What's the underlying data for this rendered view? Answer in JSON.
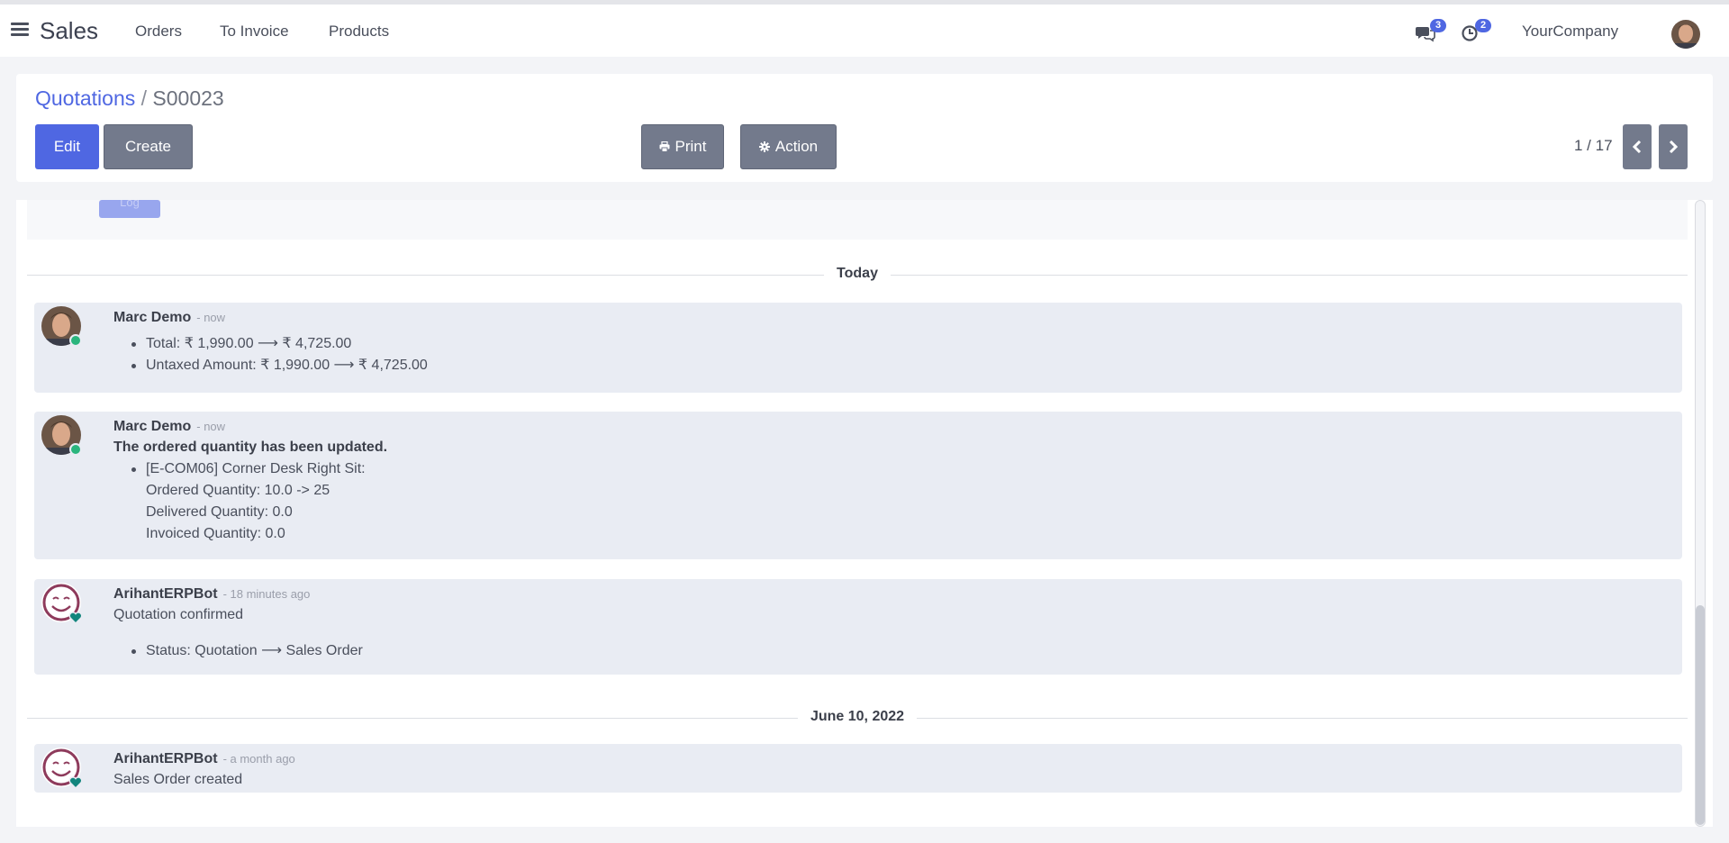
{
  "navbar": {
    "app_title": "Sales",
    "menu_items": [
      "Orders",
      "To Invoice",
      "Products"
    ],
    "messages_badge": "3",
    "activities_badge": "2",
    "company": "YourCompany"
  },
  "breadcrumb": {
    "parent": "Quotations",
    "separator": "/",
    "current": "S00023"
  },
  "buttons": {
    "edit": "Edit",
    "create": "Create",
    "print": "Print",
    "action": "Action"
  },
  "pager": {
    "value": "1 / 17"
  },
  "chatter": {
    "log_button_partial": "Log",
    "sections": [
      {
        "date_label": "Today",
        "messages": [
          {
            "author": "Marc Demo",
            "date": "- now",
            "tracking": [
              "Total: ₹ 1,990.00 ⟶ ₹ 4,725.00",
              "Untaxed Amount: ₹ 1,990.00 ⟶ ₹ 4,725.00"
            ]
          },
          {
            "author": "Marc Demo",
            "date": "- now",
            "body_bold": "The ordered quantity has been updated.",
            "lines": [
              "[E-COM06] Corner Desk Right Sit:",
              "Ordered Quantity: 10.0 -> 25",
              "Delivered Quantity: 0.0",
              "Invoiced Quantity: 0.0"
            ]
          },
          {
            "author": "ArihantERPBot",
            "date": "- 18 minutes ago",
            "body": "Quotation confirmed",
            "tracking": [
              "Status: Quotation ⟶ Sales Order"
            ]
          }
        ]
      },
      {
        "date_label": "June 10, 2022",
        "messages": [
          {
            "author": "ArihantERPBot",
            "date": "- a month ago",
            "body": "Sales Order created"
          }
        ]
      }
    ]
  },
  "colors": {
    "primary": "#4f67e2",
    "secondary_button": "#737a8c",
    "message_background": "#e9ecf3",
    "online_status": "#2ab57d",
    "bot_avatar": "#8e3b5c"
  }
}
